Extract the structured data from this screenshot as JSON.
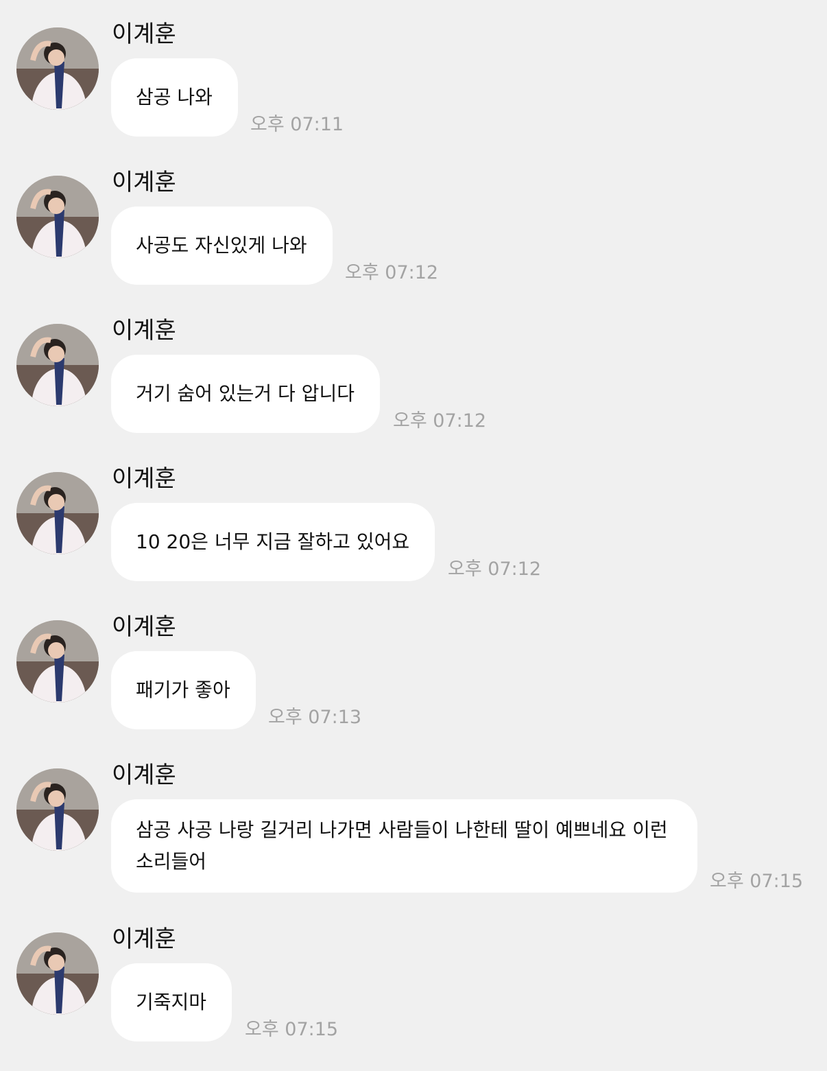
{
  "messages": [
    {
      "sender": "이계훈",
      "text": "삼공 나와",
      "time": "오후 07:11"
    },
    {
      "sender": "이계훈",
      "text": "사공도 자신있게 나와",
      "time": "오후 07:12"
    },
    {
      "sender": "이계훈",
      "text": "거기 숨어 있는거 다 압니다",
      "time": "오후 07:12"
    },
    {
      "sender": "이계훈",
      "text": "10 20은 너무 지금 잘하고 있어요",
      "time": "오후 07:12"
    },
    {
      "sender": "이계훈",
      "text": "패기가 좋아",
      "time": "오후 07:13"
    },
    {
      "sender": "이계훈",
      "text_line1": "삼공 사공 나랑 길거리 나가면 사람들이 나한테 딸이 예쁘네요 이런",
      "text_line2": "소리들어",
      "time": "오후 07:15"
    },
    {
      "sender": "이계훈",
      "text": "기죽지마",
      "time": "오후 07:15"
    }
  ],
  "colors": {
    "background": "#f0f0f0",
    "bubble": "#ffffff",
    "timestamp": "#a3a3a3"
  }
}
